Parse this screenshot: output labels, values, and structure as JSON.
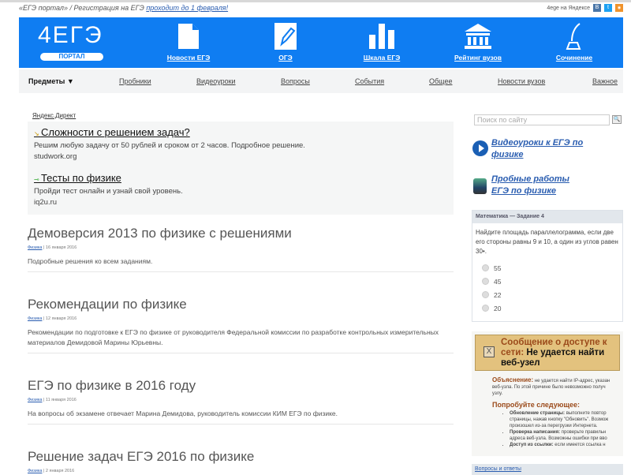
{
  "topbar": {
    "text": "«ЕГЭ портал» / Регистрация на ЕГЭ ",
    "link": "проходит до 1 февраля!",
    "yandex": "4ege на Яндексе",
    "social": [
      "В",
      "t",
      "rss"
    ]
  },
  "header": {
    "logo": "4ЕГЭ",
    "portal": "ПОРТАЛ",
    "items": [
      {
        "label": "Новости ЕГЭ",
        "icon": "document-icon"
      },
      {
        "label": "ОГЭ",
        "icon": "pencil-icon"
      },
      {
        "label": "Шкала ЕГЭ",
        "icon": "bar-chart-icon"
      },
      {
        "label": "Рейтинг вузов",
        "icon": "university-icon"
      },
      {
        "label": "Сочинение",
        "icon": "quill-icon"
      }
    ]
  },
  "nav": {
    "items": [
      "Предметы ▼",
      "Пробники",
      "Видеоуроки",
      "Вопросы",
      "События",
      "Общее",
      "Новости вузов",
      "Важное"
    ]
  },
  "ads": {
    "label": "Яндекс.Директ",
    "items": [
      {
        "title": "Сложности с решением задач?",
        "desc": "Решим любую задачу от 50 рублей и сроком от 2 часов. Подробное решение.",
        "url": "studwork.org"
      },
      {
        "title": "Тесты по физике",
        "desc": "Пройди тест онлайн и узнай свой уровень.",
        "url": "iq2u.ru"
      }
    ]
  },
  "posts": [
    {
      "title": "Демоверсия 2013 по физике с решениями",
      "cat": "Физика",
      "date": " | 16 января 2016",
      "excerpt": "Подробные решения ко всем заданиям."
    },
    {
      "title": "Рекомендации по физике",
      "cat": "Физика",
      "date": " | 12 января 2016",
      "excerpt": "Рекомендации по подготовке к ЕГЭ по физике от руководителя Федеральной комиссии по разработке контрольных измерительных материалов Демидовой Марины Юрьевны."
    },
    {
      "title": "ЕГЭ по физике в 2016 году",
      "cat": "Физика",
      "date": " | 11 января 2016",
      "excerpt": "На вопросы об экзамене отвечает Марина Демидова, руководитель комиссии КИМ ЕГЭ по физике."
    },
    {
      "title": "Решение задач ЕГЭ 2016 по физике",
      "cat": "Физика",
      "date": " | 2 января 2016",
      "excerpt": ""
    }
  ],
  "sidebar": {
    "search_placeholder": "Поиск по сайту",
    "links": [
      "Видеоуроки к ЕГЭ по физике",
      "Пробные работы ЕГЭ по физике"
    ],
    "quiz": {
      "header": "Математика — Задание 4",
      "question": "Найдите площадь параллелограмма, если две его стороны равны 9 и 10, а один из углов равен 30•.",
      "options": [
        "55",
        "45",
        "22",
        "20"
      ]
    },
    "error": {
      "title1": "Сообщение о доступе к сети:",
      "title2": "Не удается найти веб-узел",
      "expl_h": "Объяснение:",
      "expl": "не удается найти IP-адрес, указан",
      "expl2": "веб-узла. По этой причине было невозможно получ",
      "expl3": "узлу.",
      "try_h": "Попробуйте следующее:",
      "tips": [
        {
          "b": "Обновление страницы:",
          "t": " выполните повтор",
          "t2": "страницы, нажав кнопку \"Обновить\". Возмож",
          "t3": "произошел из-за перегрузки Интернета."
        },
        {
          "b": "Проверка написания:",
          "t": " проверьте правильн",
          "t2": "адреса веб-узла. Возможны ошибки при вво",
          "t3": ""
        },
        {
          "b": "Доступ из ссылки:",
          "t": " если имеется ссылка н",
          "t2": "",
          "t3": ""
        }
      ]
    },
    "qa": "Вопросы и ответы"
  }
}
